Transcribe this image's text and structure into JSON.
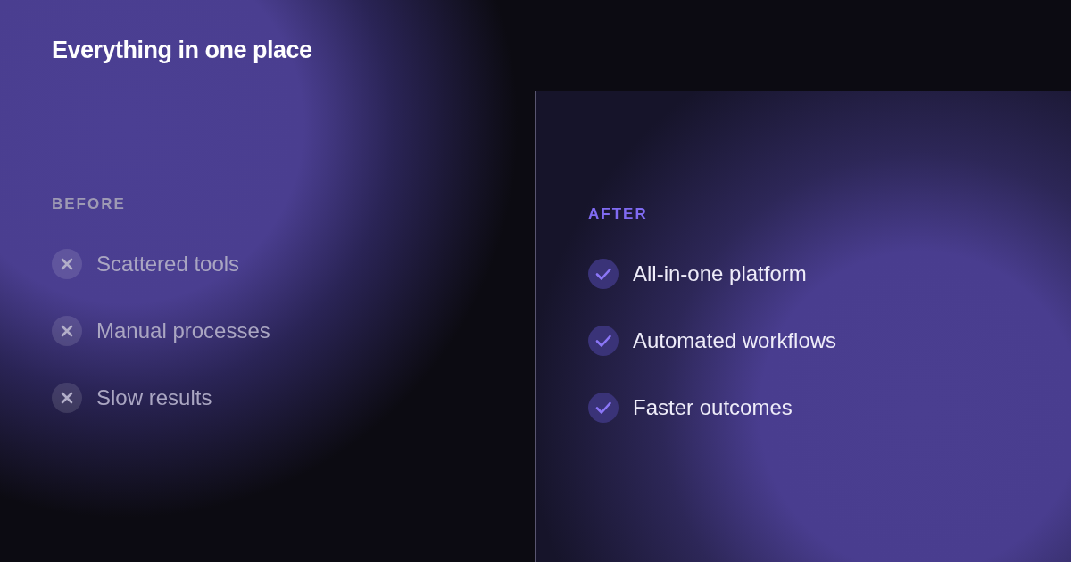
{
  "title": "Everything in one place",
  "columns": [
    {
      "kind": "before",
      "label": "BEFORE",
      "items": [
        "Scattered tools",
        "Manual processes",
        "Slow results"
      ]
    },
    {
      "kind": "after",
      "label": "AFTER",
      "items": [
        "All-in-one platform",
        "Automated workflows",
        "Faster outcomes"
      ]
    }
  ]
}
